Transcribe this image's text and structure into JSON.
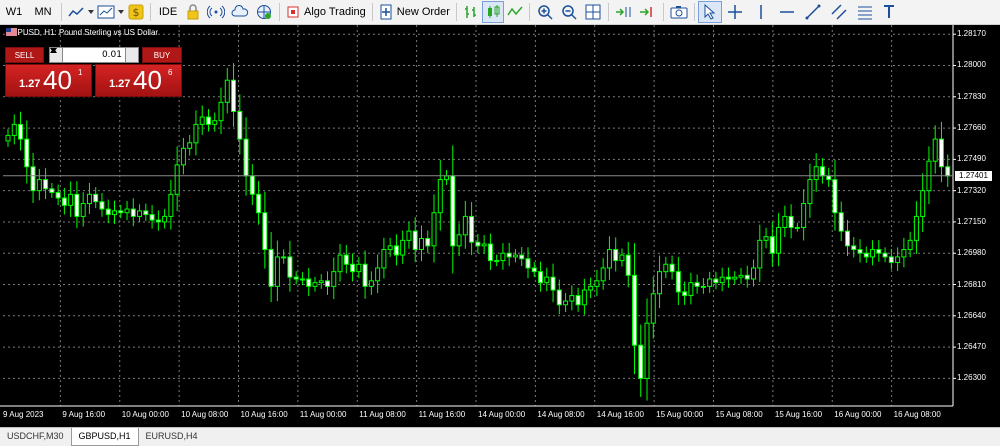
{
  "toolbar": {
    "period_w1": "W1",
    "period_mn": "MN",
    "ide": "IDE",
    "algo_trading": "Algo Trading",
    "new_order": "New Order"
  },
  "chart": {
    "title": "GBPUSD, H1:  Pound Sterling vs US Dollar",
    "symbol": "GBPUSD",
    "background": "#000000",
    "candle_color": "#00ff00",
    "up_body_color": "#000000",
    "down_body_color": "#ffffff",
    "current_price": "1.27401"
  },
  "trade_panel": {
    "sell_label": "SELL",
    "buy_label": "BUY",
    "lot_value": "0.01",
    "sell_price_base": "1.27",
    "sell_price_big": "40",
    "sell_price_sup": "1",
    "buy_price_base": "1.27",
    "buy_price_big": "40",
    "buy_price_sup": "6"
  },
  "price_axis": [
    "1.28170",
    "1.28000",
    "1.27830",
    "1.27660",
    "1.27490",
    "1.27320",
    "1.27150",
    "1.26980",
    "1.26810",
    "1.26640",
    "1.26470",
    "1.26300"
  ],
  "time_axis": [
    "9 Aug 2023",
    "9 Aug 16:00",
    "10 Aug 00:00",
    "10 Aug 08:00",
    "10 Aug 16:00",
    "11 Aug 00:00",
    "11 Aug 08:00",
    "11 Aug 16:00",
    "14 Aug 00:00",
    "14 Aug 08:00",
    "14 Aug 16:00",
    "15 Aug 00:00",
    "15 Aug 08:00",
    "15 Aug 16:00",
    "16 Aug 00:00",
    "16 Aug 08:00"
  ],
  "tabs": [
    {
      "label": "USDCHF,M30",
      "active": false
    },
    {
      "label": "GBPUSD,H1",
      "active": true
    },
    {
      "label": "EURUSD,H4",
      "active": false
    }
  ],
  "chart_data": {
    "type": "candlestick",
    "title": "GBPUSD, H1:  Pound Sterling vs US Dollar",
    "xlabel": "",
    "ylabel": "",
    "ylim": [
      1.2615,
      1.2822
    ],
    "grid": true,
    "x_ticks": [
      "9 Aug 2023",
      "9 Aug 16:00",
      "10 Aug 00:00",
      "10 Aug 08:00",
      "10 Aug 16:00",
      "11 Aug 00:00",
      "11 Aug 08:00",
      "11 Aug 16:00",
      "14 Aug 00:00",
      "14 Aug 08:00",
      "14 Aug 16:00",
      "15 Aug 00:00",
      "15 Aug 08:00",
      "15 Aug 16:00",
      "16 Aug 00:00",
      "16 Aug 08:00"
    ],
    "close_series": [
      1.2762,
      1.2768,
      1.276,
      1.2745,
      1.2732,
      1.2738,
      1.2733,
      1.2731,
      1.2728,
      1.2724,
      1.273,
      1.2718,
      1.2725,
      1.273,
      1.2726,
      1.2722,
      1.2719,
      1.2721,
      1.272,
      1.2722,
      1.2718,
      1.2721,
      1.2719,
      1.2716,
      1.2715,
      1.2718,
      1.273,
      1.2746,
      1.2755,
      1.2758,
      1.2768,
      1.2772,
      1.2768,
      1.277,
      1.278,
      1.2792,
      1.2775,
      1.276,
      1.274,
      1.273,
      1.272,
      1.27,
      1.268,
      1.2696,
      1.2696,
      1.2685,
      1.2684,
      1.2684,
      1.268,
      1.2682,
      1.2683,
      1.268,
      1.2688,
      1.2697,
      1.2692,
      1.2688,
      1.2692,
      1.268,
      1.2683,
      1.269,
      1.27,
      1.2702,
      1.2697,
      1.2705,
      1.271,
      1.27,
      1.2706,
      1.2702,
      1.272,
      1.2738,
      1.274,
      1.2702,
      1.2708,
      1.2718,
      1.2704,
      1.2702,
      1.2703,
      1.2694,
      1.2694,
      1.2698,
      1.2696,
      1.2697,
      1.2695,
      1.269,
      1.2688,
      1.2682,
      1.2685,
      1.2678,
      1.267,
      1.2672,
      1.2675,
      1.267,
      1.2678,
      1.268,
      1.2683,
      1.269,
      1.27,
      1.2694,
      1.2697,
      1.2686,
      1.2648,
      1.263,
      1.266,
      1.2676,
      1.2688,
      1.2692,
      1.2688,
      1.2677,
      1.2675,
      1.2682,
      1.268,
      1.268,
      1.2684,
      1.2682,
      1.2685,
      1.2684,
      1.2685,
      1.2686,
      1.2684,
      1.269,
      1.2705,
      1.2707,
      1.2698,
      1.2712,
      1.2718,
      1.2712,
      1.2712,
      1.2725,
      1.2738,
      1.2745,
      1.274,
      1.2738,
      1.272,
      1.271,
      1.2702,
      1.27,
      1.2698,
      1.2696,
      1.27,
      1.2698,
      1.2696,
      1.2693,
      1.2696,
      1.27,
      1.2705,
      1.2718,
      1.2732,
      1.2748,
      1.276,
      1.2745,
      1.274
    ]
  }
}
